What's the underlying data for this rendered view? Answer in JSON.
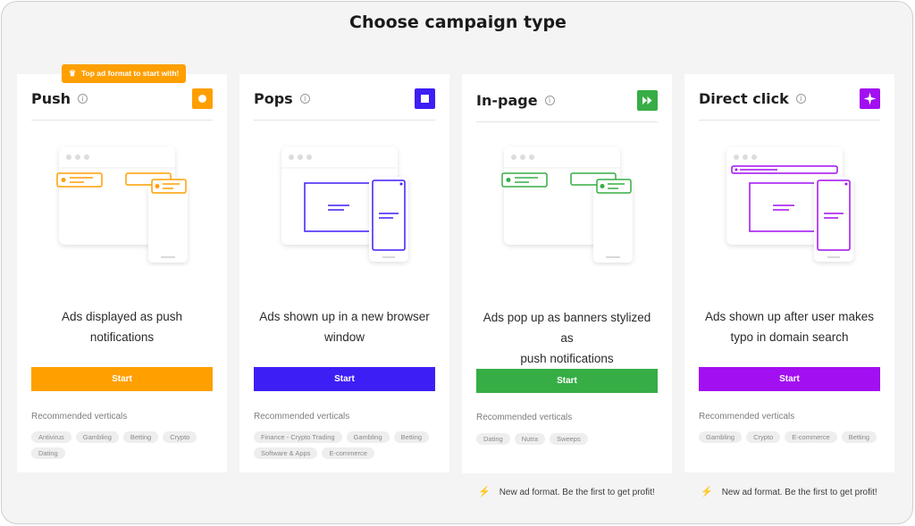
{
  "page": {
    "title": "Choose campaign type"
  },
  "badge": {
    "label": "Top ad format to start with!",
    "icon": "crown-icon",
    "color": "#ff9f00"
  },
  "recommended_label": "Recommended verticals",
  "cards": [
    {
      "title": "Push",
      "accent": "#ff9f00",
      "icon": "push-dot-icon",
      "description": [
        "Ads displayed as push",
        "notifications"
      ],
      "start_label": "Start",
      "verticals": [
        "Antivirus",
        "Gambling",
        "Betting",
        "Crypto",
        "Dating"
      ]
    },
    {
      "title": "Pops",
      "accent": "#3d1ff5",
      "icon": "popup-square-icon",
      "description": [
        "Ads shown up in a new browser",
        "window"
      ],
      "start_label": "Start",
      "verticals": [
        "Finance - Crypto Trading",
        "Gambling",
        "Betting",
        "Software & Apps",
        "E-commerce"
      ]
    },
    {
      "title": "In-page",
      "accent": "#36ad45",
      "icon": "fast-forward-icon",
      "description": [
        "Ads pop up as banners stylized as",
        "push notifications"
      ],
      "start_label": "Start",
      "verticals": [
        "Dating",
        "Nutra",
        "Sweeps"
      ],
      "note": "New ad format. Be the first to get profit!",
      "note_color": "#36ad45"
    },
    {
      "title": "Direct click",
      "accent": "#a20ff0",
      "icon": "sparkle-icon",
      "description": [
        "Ads shown up after user makes",
        "typo in domain search"
      ],
      "start_label": "Start",
      "verticals": [
        "Gambling",
        "Crypto",
        "E-commerce",
        "Betting"
      ],
      "note": "New ad format. Be the first to get profit!",
      "note_color": "#a20ff0"
    }
  ]
}
